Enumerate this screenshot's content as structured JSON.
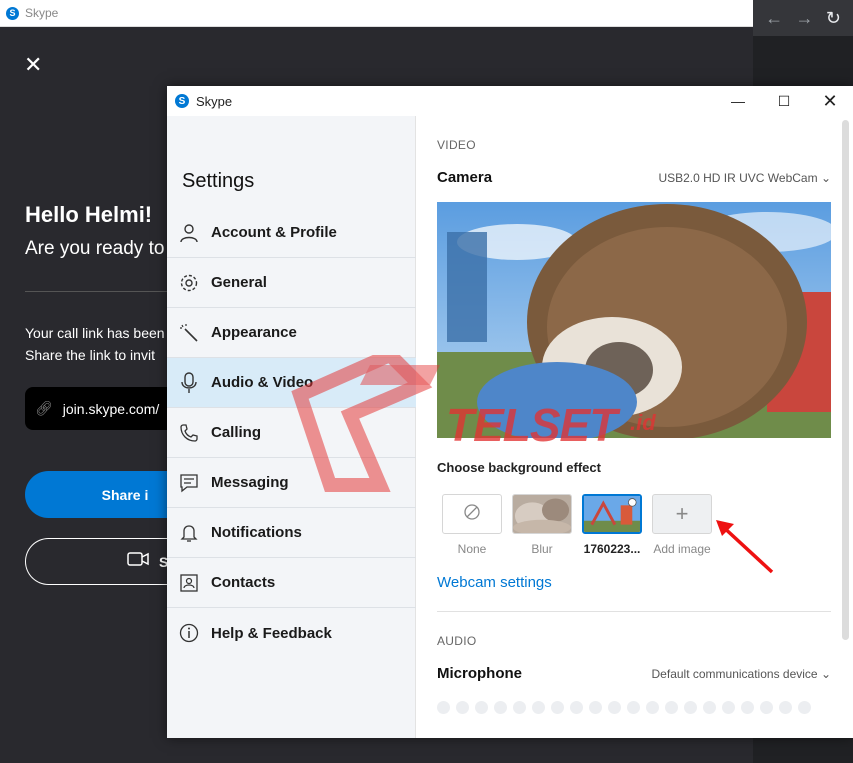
{
  "background_window": {
    "title": "Skype",
    "greeting": "Hello Helmi!",
    "subgreeting": "Are you ready to",
    "call_link_text": "Your call link has been",
    "share_link_text": "Share the link to invit",
    "link_value": "join.skype.com/",
    "share_button": "Share i",
    "start_button": "St"
  },
  "dialog": {
    "title": "Skype",
    "controls": {
      "minimize": "—",
      "maximize": "☐",
      "close": "✕"
    },
    "sidebar": {
      "heading": "Settings",
      "items": [
        {
          "label": "Account & Profile",
          "icon": "person-icon"
        },
        {
          "label": "General",
          "icon": "gear-icon"
        },
        {
          "label": "Appearance",
          "icon": "magic-wand-icon"
        },
        {
          "label": "Audio & Video",
          "icon": "microphone-icon",
          "active": true
        },
        {
          "label": "Calling",
          "icon": "phone-icon"
        },
        {
          "label": "Messaging",
          "icon": "chat-icon"
        },
        {
          "label": "Notifications",
          "icon": "bell-icon"
        },
        {
          "label": "Contacts",
          "icon": "contact-card-icon"
        },
        {
          "label": "Help & Feedback",
          "icon": "info-icon"
        }
      ]
    },
    "content": {
      "video_section": "VIDEO",
      "camera_label": "Camera",
      "camera_value": "USB2.0 HD IR UVC WebCam",
      "background_effect_label": "Choose background effect",
      "effects": [
        {
          "label": "None"
        },
        {
          "label": "Blur"
        },
        {
          "label": "1760223...",
          "selected": true
        },
        {
          "label": "Add image"
        }
      ],
      "webcam_settings_link": "Webcam settings",
      "audio_section": "AUDIO",
      "microphone_label": "Microphone",
      "microphone_value": "Default communications device"
    }
  },
  "watermark": {
    "text": "TELSET",
    "suffix": ".id"
  },
  "colors": {
    "accent": "#0078d4",
    "watermark": "#e23232",
    "dark_bg": "#29292e"
  }
}
